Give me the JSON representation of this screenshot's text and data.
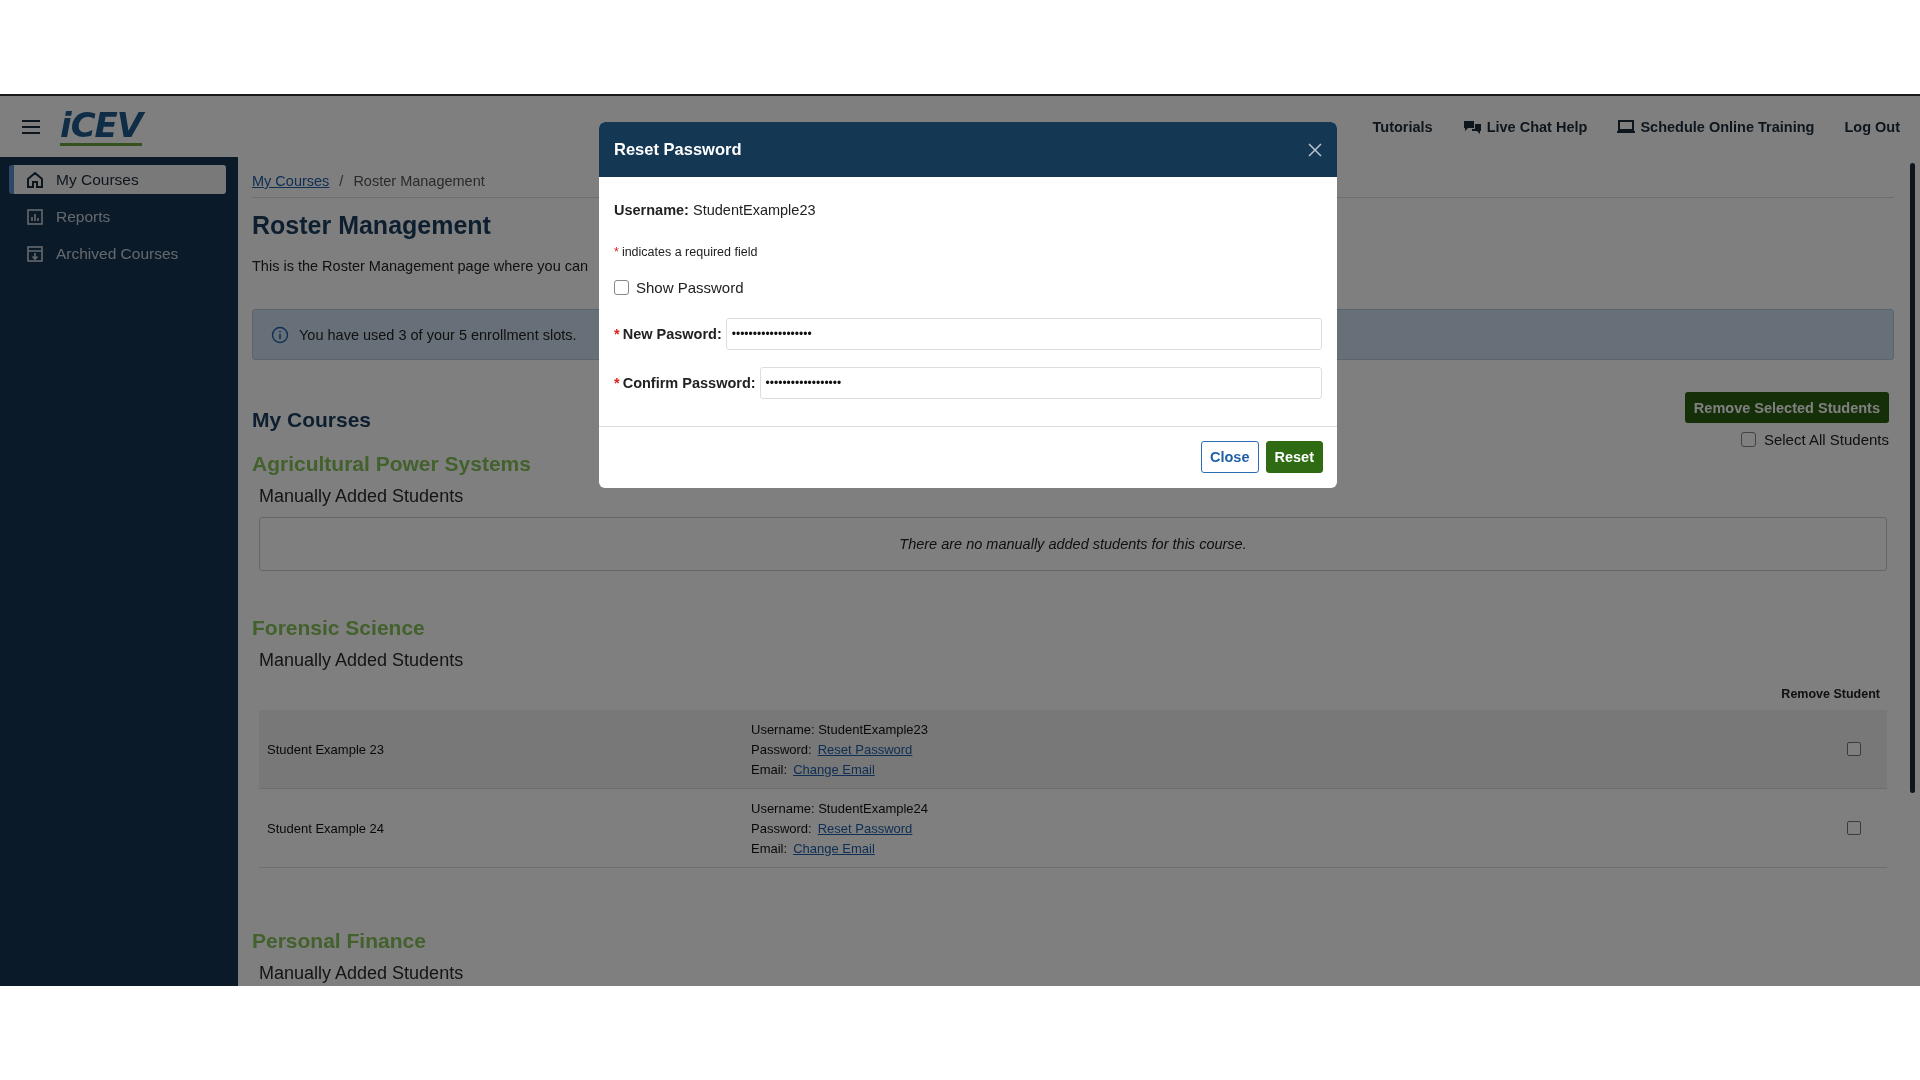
{
  "header": {
    "logo": "iCEV",
    "nav": [
      {
        "label": "Tutorials"
      },
      {
        "label": "Live Chat Help"
      },
      {
        "label": "Schedule Online Training"
      },
      {
        "label": "Log Out"
      }
    ]
  },
  "sidebar": {
    "items": [
      {
        "label": "My Courses",
        "selected": true
      },
      {
        "label": "Reports",
        "selected": false
      },
      {
        "label": "Archived Courses",
        "selected": false
      }
    ]
  },
  "breadcrumbs": [
    {
      "label": "My Courses",
      "kind": "link"
    },
    {
      "label": "/",
      "kind": "separator"
    },
    {
      "label": "Roster Management",
      "kind": "current"
    }
  ],
  "page": {
    "title": "Roster Management",
    "description": "This is the Roster Management page where you can",
    "alert": "You have used 3 of your 5 enrollment slots.",
    "section_title": "My Courses",
    "remove_button": "Remove Selected Students",
    "select_all": {
      "label": "Select All Students",
      "checked": false
    }
  },
  "courses": [
    {
      "name": "Agricultural Power Systems",
      "subheading": "Manually Added Students",
      "empty_message": "There are no manually added students for this course."
    },
    {
      "name": "Forensic Science",
      "subheading": "Manually Added Students",
      "remove_column": "Remove Student",
      "students": [
        {
          "name": "Student Example 23",
          "username": "Username: StudentExample23",
          "password_label": "Password:",
          "password_link": "Reset Password",
          "email_label": "Email:",
          "email_link": "Change Email",
          "checked": false
        },
        {
          "name": "Student Example 24",
          "username": "Username: StudentExample24",
          "password_label": "Password:",
          "password_link": "Reset Password",
          "email_label": "Email:",
          "email_link": "Change Email",
          "checked": false
        }
      ]
    },
    {
      "name": "Personal Finance",
      "subheading": "Manually Added Students"
    }
  ],
  "dialog": {
    "title": "Reset Password",
    "username_label": "Username:",
    "username": "StudentExample23",
    "required_mark": "*",
    "required_note": "indicates a required field",
    "show_password": {
      "label": "Show Password",
      "checked": false
    },
    "fields": [
      {
        "label": "New Pasword:",
        "value": "•••••••••••••••••••",
        "required": true
      },
      {
        "label": "Confirm Password:",
        "value": "••••••••••••••••••",
        "required": true
      }
    ],
    "buttons": [
      {
        "label": "Close",
        "kind": "secondary"
      },
      {
        "label": "Reset",
        "kind": "primary"
      }
    ]
  }
}
